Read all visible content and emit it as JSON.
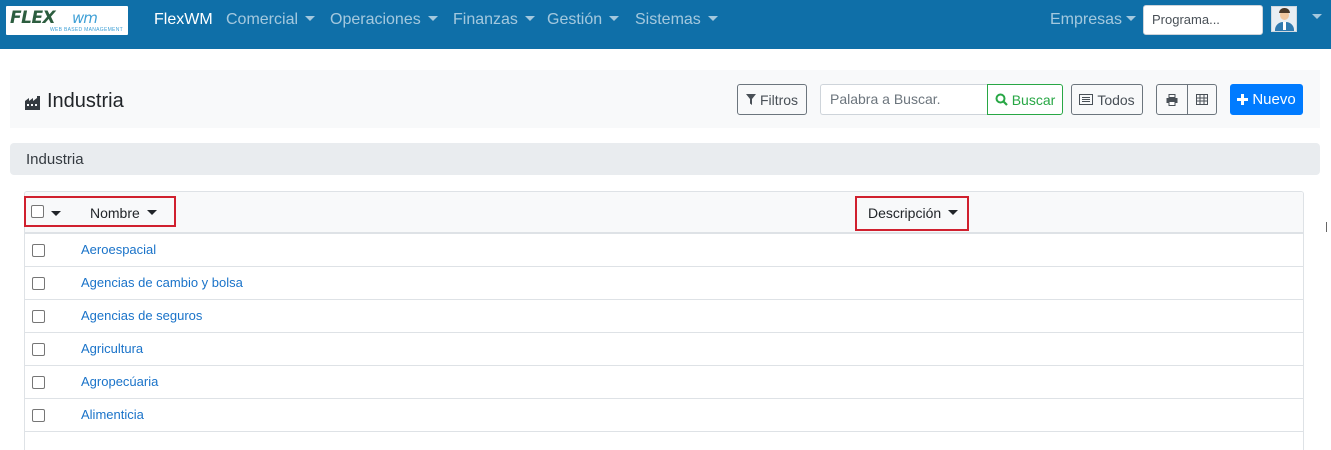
{
  "navbar": {
    "logo_main": "FLEX",
    "logo_accent": "wm",
    "logo_subtitle": "WEB BASED MANAGEMENT",
    "brand": "FlexWM",
    "menus": [
      {
        "label": "Comercial"
      },
      {
        "label": "Operaciones"
      },
      {
        "label": "Finanzas"
      },
      {
        "label": "Gestión"
      },
      {
        "label": "Sistemas"
      }
    ],
    "empresas_label": "Empresas",
    "program_input_value": "Programa...",
    "colors": {
      "background": "#0f6fa8"
    }
  },
  "page": {
    "title": "Industria",
    "icon": "factory-icon",
    "filters_label": "Filtros",
    "search_placeholder": "Palabra a Buscar.",
    "search_button_label": "Buscar",
    "all_button_label": "Todos",
    "new_button_label": "Nuevo"
  },
  "section": {
    "title": "Industria"
  },
  "table": {
    "columns": [
      "Nombre",
      "Descripción"
    ],
    "rows": [
      {
        "name": "Aeroespacial",
        "description": ""
      },
      {
        "name": "Agencias de cambio y bolsa",
        "description": ""
      },
      {
        "name": "Agencias de seguros",
        "description": ""
      },
      {
        "name": "Agricultura",
        "description": ""
      },
      {
        "name": "Agropecúaria",
        "description": ""
      },
      {
        "name": "Alimenticia",
        "description": ""
      }
    ]
  }
}
